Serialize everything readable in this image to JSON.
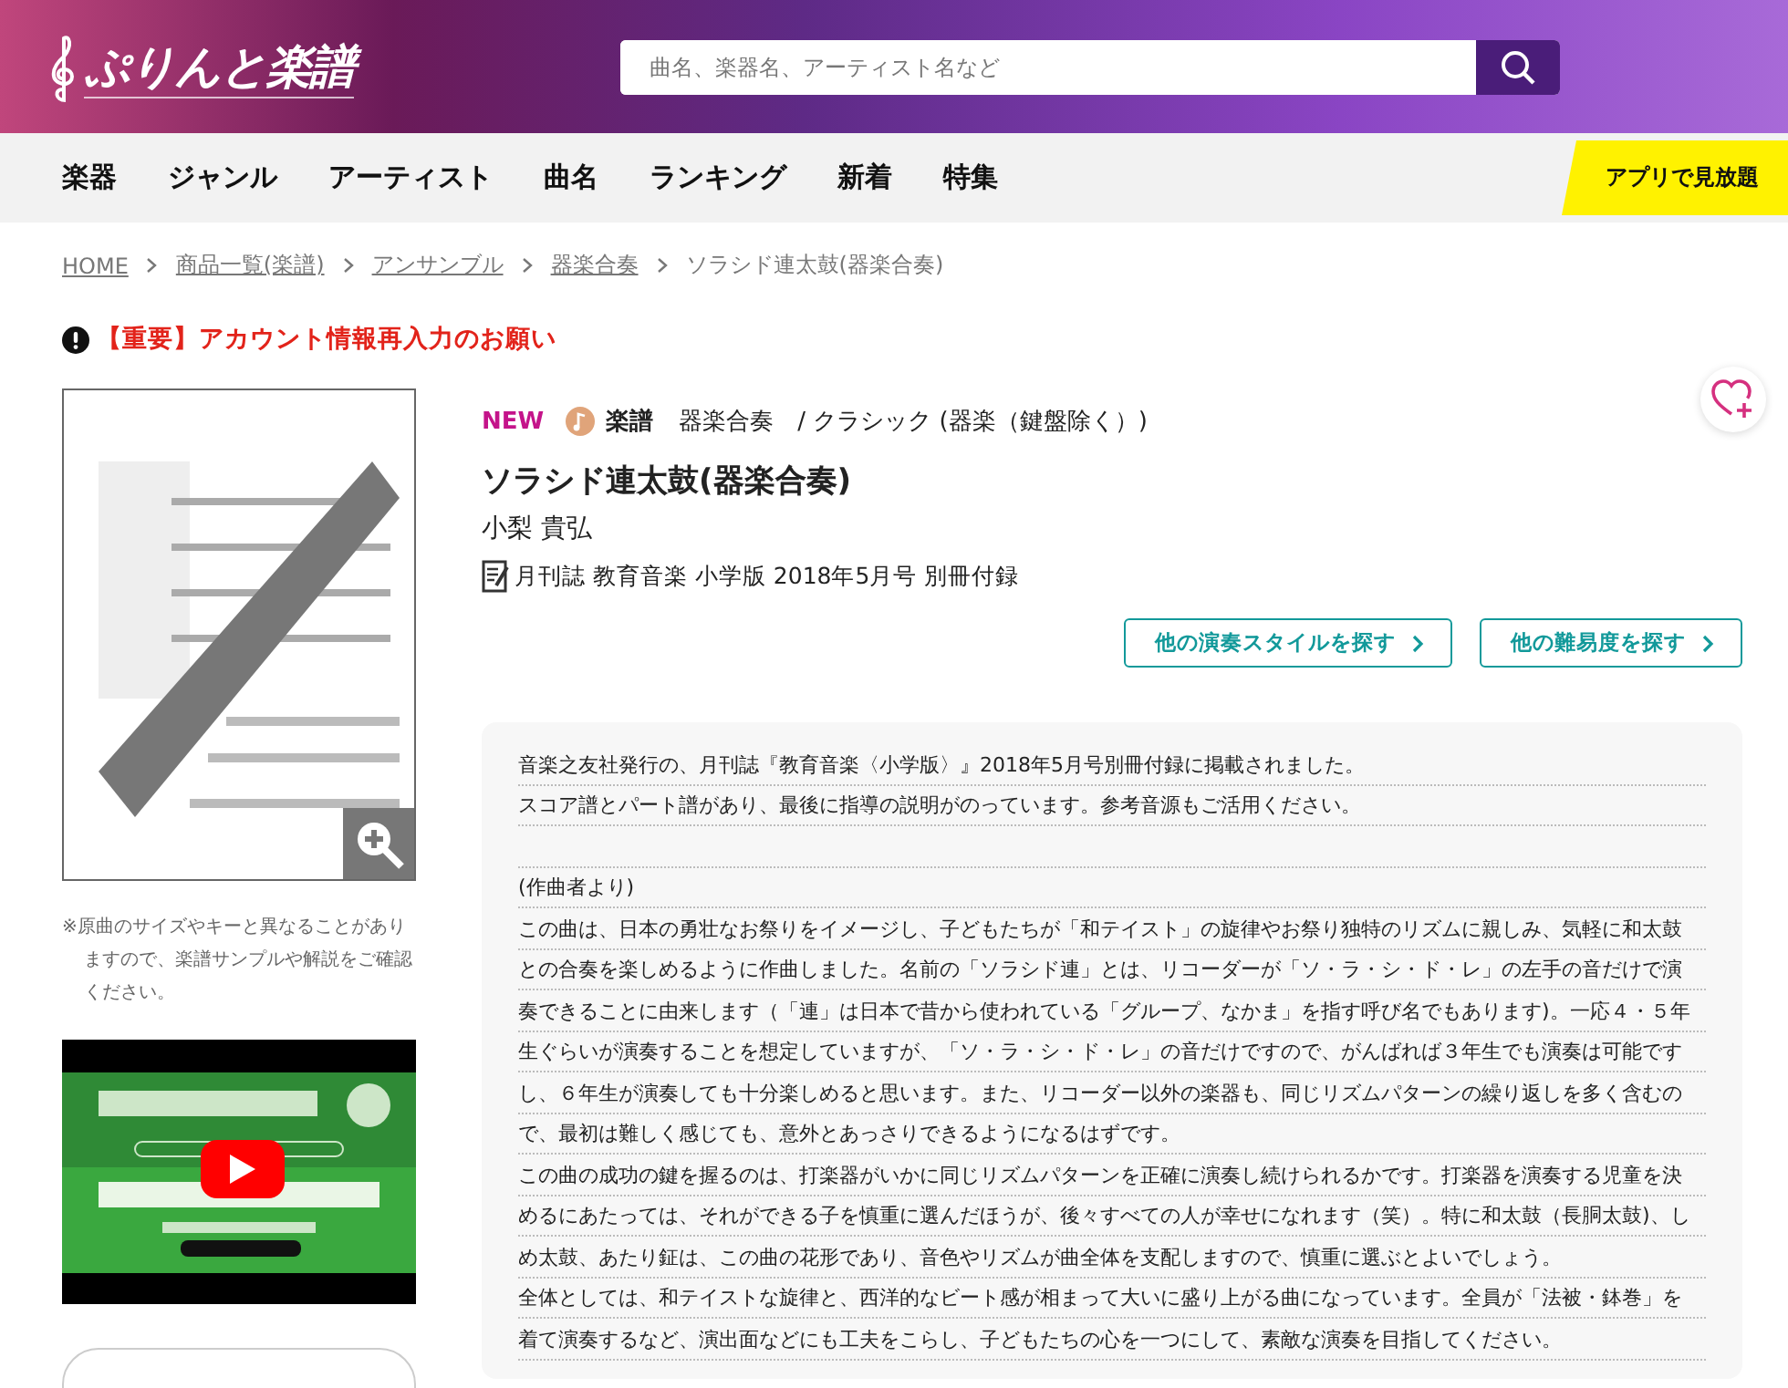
{
  "header": {
    "logo": "ぷりんと楽譜",
    "search": {
      "placeholder": "曲名、楽器名、アーティスト名など"
    }
  },
  "nav": {
    "items": [
      "楽器",
      "ジャンル",
      "アーティスト",
      "曲名",
      "ランキング",
      "新着",
      "特集"
    ],
    "app_banner": "アプリで見放題"
  },
  "breadcrumb": [
    {
      "label": "HOME",
      "link": true
    },
    {
      "label": "商品一覧(楽譜)",
      "link": true
    },
    {
      "label": "アンサンブル",
      "link": true
    },
    {
      "label": "器楽合奏",
      "link": true
    },
    {
      "label": "ソラシド連太鼓(器楽合奏)",
      "link": false
    }
  ],
  "notice": "【重要】アカウント情報再入力のお願い",
  "left": {
    "note": "※原曲のサイズやキーと異なることがありますので、楽譜サンプルや解説をご確認ください。"
  },
  "product": {
    "badge": "NEW",
    "type": "楽譜",
    "categories": "器楽合奏　/ クラシック (器楽（鍵盤除く）)",
    "title": "ソラシド連太鼓(器楽合奏)",
    "composer": "小梨 貴弘",
    "publication": "月刊誌 教育音楽 小学版 2018年5月号 別冊付録",
    "buttons": [
      "他の演奏スタイルを探す",
      "他の難易度を探す"
    ]
  },
  "description": [
    {
      "kind": "text",
      "text": "音楽之友社発行の、月刊誌『教育音楽〈小学版〉』2018年5月号別冊付録に掲載されました。"
    },
    {
      "kind": "text",
      "text": "スコア譜とパート譜があり、最後に指導の説明がのっています。参考音源もご活用ください。"
    },
    {
      "kind": "blank"
    },
    {
      "kind": "text",
      "text": "(作曲者より)"
    },
    {
      "kind": "text",
      "text": "この曲は、日本の勇壮なお祭りをイメージし、子どもたちが「和テイスト」の旋律やお祭り独特のリズムに親しみ、気軽に和太鼓"
    },
    {
      "kind": "text",
      "text": "との合奏を楽しめるように作曲しました。名前の「ソラシド連」とは、リコーダーが「ソ・ラ・シ・ド・レ」の左手の音だけで演"
    },
    {
      "kind": "text",
      "text": "奏できることに由来します（「連」は日本で昔から使われている「グループ、なかま」を指す呼び名でもあります)。一応４・５年"
    },
    {
      "kind": "text",
      "text": "生ぐらいが演奏することを想定していますが、「ソ・ラ・シ・ド・レ」の音だけですので、がんばれば３年生でも演奏は可能です"
    },
    {
      "kind": "text",
      "text": "し、６年生が演奏しても十分楽しめると思います。また、リコーダー以外の楽器も、同じリズムパターンの繰り返しを多く含むの"
    },
    {
      "kind": "text",
      "text": "で、最初は難しく感じても、意外とあっさりできるようになるはずです。"
    },
    {
      "kind": "text",
      "text": "この曲の成功の鍵を握るのは、打楽器がいかに同じリズムパターンを正確に演奏し続けられるかです。打楽器を演奏する児童を決"
    },
    {
      "kind": "text",
      "text": "めるにあたっては、それができる子を慎重に選んだほうが、後々すべての人が幸せになれます（笑）。特に和太鼓（長胴太鼓)、し"
    },
    {
      "kind": "text",
      "text": "め太鼓、あたり鉦は、この曲の花形であり、音色やリズムが曲全体を支配しますので、慎重に選ぶとよいでしょう。"
    },
    {
      "kind": "text",
      "text": "全体としては、和テイストな旋律と、西洋的なビート感が相まって大いに盛り上がる曲になっています。全員が「法被・鉢巻」を"
    },
    {
      "kind": "text",
      "text": "着て演奏するなど、演出面などにも工夫をこらし、子どもたちの心を一つにして、素敵な演奏を目指してください。"
    }
  ]
}
